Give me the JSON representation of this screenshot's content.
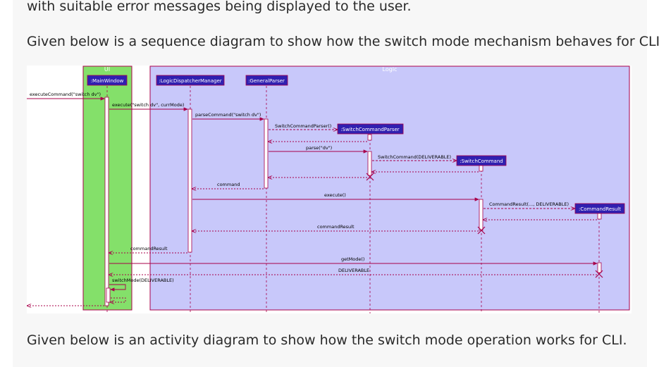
{
  "text": {
    "top_fragment": "with suitable error messages being displayed to the user.",
    "seq_intro": "Given below is a sequence diagram to show how the switch mode mechanism behaves for CLI.",
    "activity_intro": "Given below is an activity diagram to show how the switch mode operation works for CLI."
  },
  "diagram": {
    "ui_box_label": "UI",
    "logic_box_label": "Logic",
    "participants": {
      "main_window": ":MainWindow",
      "logic_dispatcher": ":LogicDispatcherManager",
      "general_parser": ":GeneralParser",
      "switch_command_parser": ":SwitchCommandParser",
      "switch_command": ":SwitchCommand",
      "command_result": ":CommandResult"
    },
    "messages": {
      "execute_command": "executeCommand(\"switch dv\")",
      "execute": "execute(\"switch dv\", currMode)",
      "parse_command": "parseCommand(\"switch dv\")",
      "create_parser": "SwitchCommandParser()",
      "parse": "parse(\"dv\")",
      "create_command": "SwitchCommand(DELIVERABLE)",
      "return_command": "command",
      "execute_cmd": "execute()",
      "create_result": "CommandResult(..., DELIVERABLE)",
      "return_command_result": "commandResult",
      "return_command_result_ui": "commandResult",
      "get_mode": "getMode()",
      "return_mode": "DELIVERABLE",
      "switch_mode": "switchMode(DELIVERABLE)"
    },
    "colors": {
      "ui_fill": "#84e06a",
      "logic_fill": "#c8c8fa",
      "participant_fill": "#3020b0",
      "arrow": "#a8004a"
    }
  }
}
